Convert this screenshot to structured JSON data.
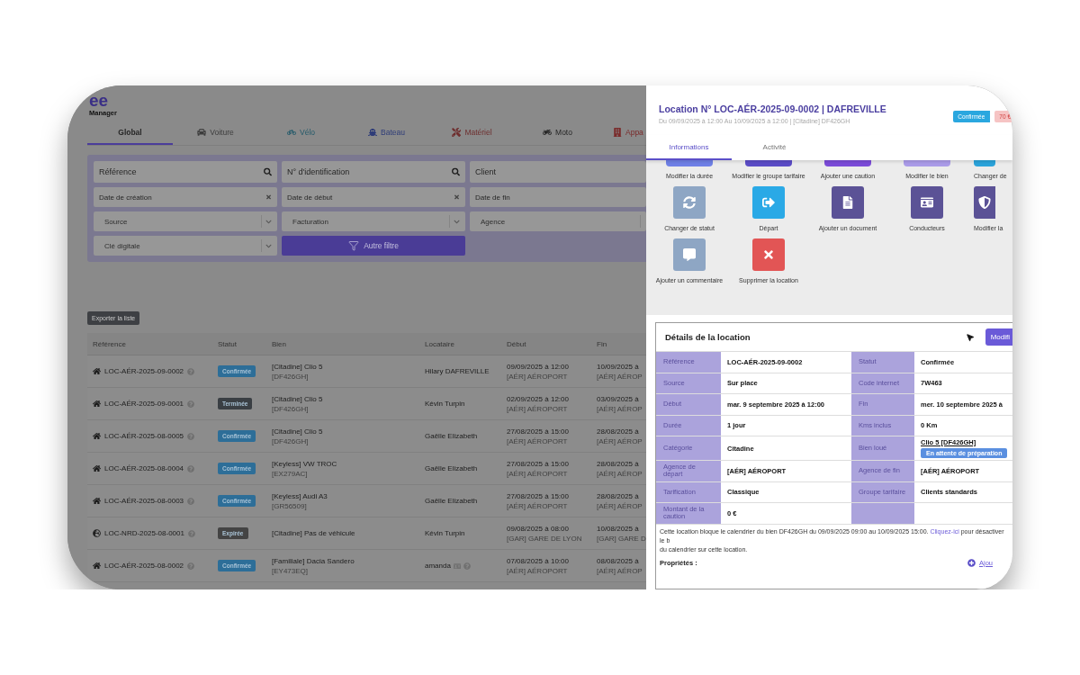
{
  "logo": {
    "mark": "ee",
    "name": "Manager"
  },
  "category_tabs": [
    {
      "label": "Global",
      "kind": "all",
      "selected": true
    },
    {
      "label": "Voiture",
      "kind": "car",
      "selected": false
    },
    {
      "label": "Vélo",
      "kind": "bike",
      "selected": false
    },
    {
      "label": "Bateau",
      "kind": "boat",
      "selected": false
    },
    {
      "label": "Matériel",
      "kind": "tools",
      "selected": false
    },
    {
      "label": "Moto",
      "kind": "moto",
      "selected": false
    },
    {
      "label": "Appa",
      "kind": "building",
      "selected": false
    }
  ],
  "filters": [
    {
      "kind": "search",
      "placeholder": "Référence",
      "trailing_icon": true
    },
    {
      "kind": "search",
      "placeholder": "N° d'identification",
      "trailing_icon": true
    },
    {
      "kind": "search",
      "placeholder": "Client",
      "trailing_icon": false
    },
    {
      "kind": "date",
      "placeholder": "Date de création",
      "trailing_icon": true
    },
    {
      "kind": "date",
      "placeholder": "Date de début",
      "trailing_icon": true
    },
    {
      "kind": "date",
      "placeholder": "Date de fin",
      "trailing_icon": false
    },
    {
      "kind": "select",
      "label": "Source",
      "trailing_icon": true
    },
    {
      "kind": "select",
      "label": "Facturation",
      "trailing_icon": true
    },
    {
      "kind": "select",
      "label": "Agence",
      "trailing_icon": false
    },
    {
      "kind": "select",
      "label": "Clé digitale",
      "trailing_icon": true
    },
    {
      "kind": "button",
      "label": "Autre filtre"
    }
  ],
  "export_button": "Exporter la liste",
  "table": {
    "columns": [
      "Référence",
      "Statut",
      "Bien",
      "Locataire",
      "Début",
      "Fin"
    ],
    "rows": [
      {
        "kind": "home",
        "reference": "LOC-AÉR-2025-09-0002",
        "status": {
          "kind": "confirmed",
          "label": "Confirmée"
        },
        "asset": "[Citadine] Clio 5",
        "plate": "[DF426GH]",
        "tenant": "Hilary DAFREVILLE",
        "tenant_icons": false,
        "start": "09/09/2025 à 12:00",
        "start_agency": "[AÉR] AÉROPORT",
        "end": "10/09/2025 à",
        "end_agency": "[AÉR] AÉROP"
      },
      {
        "kind": "home",
        "reference": "LOC-AÉR-2025-09-0001",
        "status": {
          "kind": "finished",
          "label": "Terminée"
        },
        "asset": "[Citadine] Clio 5",
        "plate": "[DF426GH]",
        "tenant": "Kévin Turpin",
        "tenant_icons": false,
        "start": "02/09/2025 à 12:00",
        "start_agency": "[AÉR] AÉROPORT",
        "end": "03/09/2025 à",
        "end_agency": "[AÉR] AÉROP"
      },
      {
        "kind": "home",
        "reference": "LOC-AÉR-2025-08-0005",
        "status": {
          "kind": "confirmed",
          "label": "Confirmée"
        },
        "asset": "[Citadine] Clio 5",
        "plate": "[DF426GH]",
        "tenant": "Gaëlle Elizabeth",
        "tenant_icons": false,
        "start": "27/08/2025 à 15:00",
        "start_agency": "[AÉR] AÉROPORT",
        "end": "28/08/2025 à",
        "end_agency": "[AÉR] AÉROP"
      },
      {
        "kind": "home",
        "reference": "LOC-AÉR-2025-08-0004",
        "status": {
          "kind": "confirmed",
          "label": "Confirmée"
        },
        "asset": "[Keyless] VW TROC",
        "plate": "[EX279AC]",
        "tenant": "Gaëlle Elizabeth",
        "tenant_icons": false,
        "start": "27/08/2025 à 15:00",
        "start_agency": "[AÉR] AÉROPORT",
        "end": "28/08/2025 à",
        "end_agency": "[AÉR] AÉROP"
      },
      {
        "kind": "home",
        "reference": "LOC-AÉR-2025-08-0003",
        "status": {
          "kind": "confirmed",
          "label": "Confirmée"
        },
        "asset": "[Keyless] Audi A3",
        "plate": "[GR56509]",
        "tenant": "Gaëlle Elizabeth",
        "tenant_icons": false,
        "start": "27/08/2025 à 15:00",
        "start_agency": "[AÉR] AÉROPORT",
        "end": "28/08/2025 à",
        "end_agency": "[AÉR] AÉROP"
      },
      {
        "kind": "globe",
        "reference": "LOC-NRD-2025-08-0001",
        "status": {
          "kind": "expired",
          "label": "Expirée"
        },
        "asset": "[Citadine] Pas de véhicule",
        "tenant": "Kévin Turpin",
        "tenant_icons": false,
        "start": "09/08/2025 à 08:00",
        "start_agency": "[GAR] GARE DE LYON",
        "end": "10/08/2025 à",
        "end_agency": "[GAR] GARE D"
      },
      {
        "kind": "home",
        "reference": "LOC-AÉR-2025-08-0002",
        "status": {
          "kind": "confirmed",
          "label": "Confirmée"
        },
        "asset": "[Familiale] Dacia Sandero",
        "plate": "[EY473EQ]",
        "tenant": "amanda",
        "tenant_icons": true,
        "start": "07/08/2025 à 10:00",
        "start_agency": "[AÉR] AÉROPORT",
        "end": "08/08/2025 à",
        "end_agency": "[AÉR] AÉROP"
      }
    ]
  },
  "detail_panel": {
    "title": "Location N° LOC-AÉR-2025-09-0002 | DAFREVILLE",
    "subtitle": "Du 09/09/2025 à 12:00 Au 10/09/2025 à 12:00 | [Citadine] DF426GH",
    "badges": [
      {
        "kind": "status",
        "label": "Confirmée"
      },
      {
        "kind": "amount",
        "label": "70 €"
      }
    ],
    "tabs": [
      {
        "label": "Informations",
        "selected": true
      },
      {
        "label": "Activité",
        "selected": false
      }
    ],
    "action_rows": [
      {
        "clipped": true,
        "items": [
          {
            "label": "Modifier la durée",
            "color": "#6f80e6"
          },
          {
            "label": "Modifier le groupe tarifaire",
            "color": "#5b4cc6"
          },
          {
            "label": "Ajouter une caution",
            "color": "#7b4bd8"
          },
          {
            "label": "Modifier le bien",
            "color": "#aa9be8"
          },
          {
            "label": "Changer de",
            "color": "#2ba3da"
          }
        ]
      },
      {
        "clipped": false,
        "items": [
          {
            "label": "Changer de statut",
            "color": "#8ea6c4",
            "kind": "refresh"
          },
          {
            "label": "Départ",
            "color": "#2aa9e6",
            "kind": "exit"
          },
          {
            "label": "Ajouter un document",
            "color": "#5b5296",
            "kind": "document"
          },
          {
            "label": "Conducteurs",
            "color": "#5b5296",
            "kind": "card"
          },
          {
            "label": "Modifier la",
            "color": "#5b5296",
            "kind": "shield"
          }
        ]
      },
      {
        "clipped": false,
        "items": [
          {
            "label": "Ajouter un commentaire",
            "color": "#8ea6c4",
            "kind": "comment"
          },
          {
            "label": "Supprimer la location",
            "color": "#e25555",
            "kind": "delete"
          }
        ]
      }
    ],
    "details": {
      "title": "Détails de la location",
      "edit_button": "Modifi",
      "rows": [
        [
          {
            "kind": "label",
            "text": "Référence"
          },
          {
            "kind": "value",
            "text": "LOC-AÉR-2025-09-0002"
          },
          {
            "kind": "label",
            "text": "Statut"
          },
          {
            "kind": "value",
            "text": "Confirmée"
          }
        ],
        [
          {
            "kind": "label",
            "text": "Source"
          },
          {
            "kind": "value",
            "text": "Sur place"
          },
          {
            "kind": "label",
            "text": "Code internet"
          },
          {
            "kind": "value",
            "text": "7W463"
          }
        ],
        [
          {
            "kind": "label",
            "text": "Début"
          },
          {
            "kind": "value",
            "text": "mar. 9 septembre 2025 à 12:00"
          },
          {
            "kind": "label",
            "text": "Fin"
          },
          {
            "kind": "value",
            "text": "mer. 10 septembre 2025 à"
          }
        ],
        [
          {
            "kind": "label",
            "text": "Durée"
          },
          {
            "kind": "value",
            "text": "1 jour"
          },
          {
            "kind": "label",
            "text": "Kms inclus"
          },
          {
            "kind": "value",
            "text": "0 Km"
          }
        ],
        [
          {
            "kind": "label",
            "text": "Catégorie"
          },
          {
            "kind": "value",
            "text": "Citadine"
          },
          {
            "kind": "label",
            "text": "Bien loué"
          },
          {
            "kind": "asset",
            "text": "Clio 5 [DF426GH]",
            "badge": "En attente de préparation"
          }
        ],
        [
          {
            "kind": "label",
            "text": "Agence de départ"
          },
          {
            "kind": "value",
            "text": "[AÉR] AÉROPORT"
          },
          {
            "kind": "label",
            "text": "Agence de fin"
          },
          {
            "kind": "value",
            "text": "[AÉR] AÉROPORT"
          }
        ],
        [
          {
            "kind": "label",
            "text": "Tarification"
          },
          {
            "kind": "value",
            "text": "Classique"
          },
          {
            "kind": "label",
            "text": "Groupe tarifaire"
          },
          {
            "kind": "value",
            "text": "Clients standards"
          }
        ],
        [
          {
            "kind": "label",
            "text": "Montant de la caution"
          },
          {
            "kind": "value",
            "text": "0 €"
          },
          {
            "kind": "label"
          },
          {
            "kind": "value"
          }
        ]
      ],
      "note": {
        "before": "Cette location bloque le calendrier du bien DF426GH du 09/09/2025 09:00 au 10/09/2025 15:00.",
        "link": "Cliquez-ici",
        "after": "pour désactiver le b",
        "line2": "du calendrier sur cette location."
      },
      "properties_label": "Propriétés :",
      "add_link": "Ajou"
    }
  }
}
